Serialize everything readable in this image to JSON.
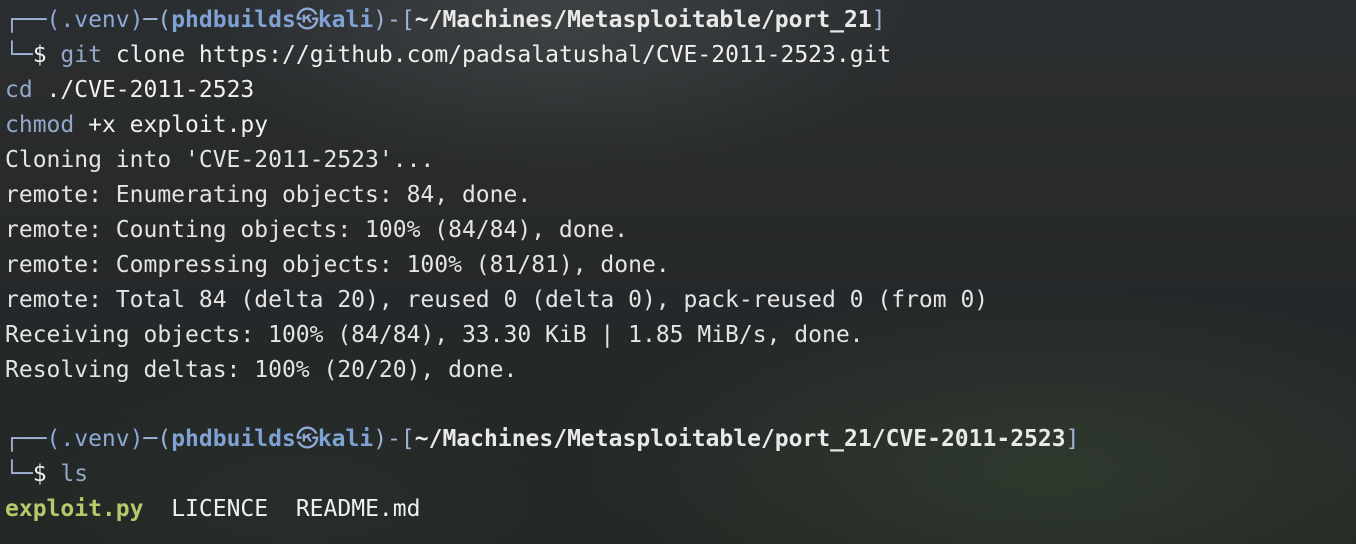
{
  "prompt1": {
    "corner_top": "┌──",
    "venv": "(.venv)",
    "dash": "─",
    "user": "phdbuilds",
    "separator_icon": "㉿",
    "host": "kali",
    "bracket_open": ")-[",
    "path": "~/Machines/Metasploitable/port_21",
    "bracket_close": "]",
    "corner_bottom": "└─",
    "dollar": "$",
    "command": "git clone https://github.com/padsalatushal/CVE-2011-2523.git"
  },
  "extra_commands": [
    {
      "cmd": "cd",
      "args": " ./CVE-2011-2523"
    },
    {
      "cmd": "chmod",
      "args": " +x exploit.py"
    }
  ],
  "output": [
    "Cloning into 'CVE-2011-2523'...",
    "remote: Enumerating objects: 84, done.",
    "remote: Counting objects: 100% (84/84), done.",
    "remote: Compressing objects: 100% (81/81), done.",
    "remote: Total 84 (delta 20), reused 0 (delta 0), pack-reused 0 (from 0)",
    "Receiving objects: 100% (84/84), 33.30 KiB | 1.85 MiB/s, done.",
    "Resolving deltas: 100% (20/20), done."
  ],
  "prompt2": {
    "corner_top": "┌──",
    "venv": "(.venv)",
    "dash": "─",
    "user": "phdbuilds",
    "separator_icon": "㉿",
    "host": "kali",
    "bracket_open": ")-[",
    "path": "~/Machines/Metasploitable/port_21/CVE-2011-2523",
    "bracket_close": "]",
    "corner_bottom": "└─",
    "dollar": "$",
    "command": "ls"
  },
  "ls_output": {
    "file1": "exploit.py",
    "file2": "LICENCE",
    "file3": "README.md"
  }
}
